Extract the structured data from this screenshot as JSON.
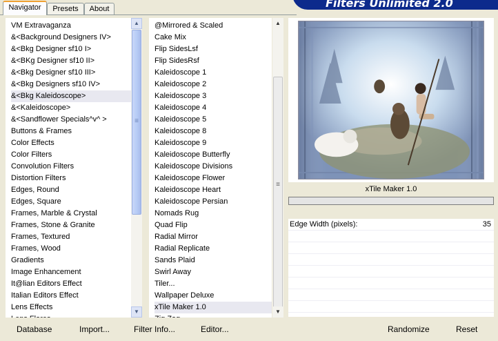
{
  "tabs": [
    {
      "label": "Navigator",
      "active": true
    },
    {
      "label": "Presets",
      "active": false
    },
    {
      "label": "About",
      "active": false
    }
  ],
  "logo_text": "Filters Unlimited 2.0",
  "categories": [
    "VM Extravaganza",
    "&<Background Designers IV>",
    "&<Bkg Designer sf10 I>",
    "&<BKg Designer sf10 II>",
    "&<Bkg Designer sf10 III>",
    "&<Bkg Designers sf10 IV>",
    "&<Bkg Kaleidoscope>",
    "&<Kaleidoscope>",
    "&<Sandflower Specials^v^ >",
    "Buttons & Frames",
    "Color Effects",
    "Color Filters",
    "Convolution Filters",
    "Distortion Filters",
    "Edges, Round",
    "Edges, Square",
    "Frames, Marble & Crystal",
    "Frames, Stone & Granite",
    "Frames, Textured",
    "Frames, Wood",
    "Gradients",
    "Image Enhancement",
    "It@lian Editors Effect",
    "Italian Editors Effect",
    "Lens Effects",
    "Lens Flares"
  ],
  "selected_category_index": 6,
  "filters": [
    "@Mirrored & Scaled",
    "Cake Mix",
    "Flip SidesLsf",
    "Flip SidesRsf",
    "Kaleidoscope 1",
    "Kaleidoscope 2",
    "Kaleidoscope 3",
    "Kaleidoscope 4",
    "Kaleidoscope 5",
    "Kaleidoscope 8",
    "Kaleidoscope 9",
    "Kaleidoscope Butterfly",
    "Kaleidoscope Divisions",
    "Kaleidoscope Flower",
    "Kaleidoscope Heart",
    "Kaleidoscope Persian",
    "Nomads Rug",
    "Quad Flip",
    "Radial Mirror",
    "Radial Replicate",
    "Sands Plaid",
    "Swirl Away",
    "Tiler...",
    "Wallpaper Deluxe",
    "xTile Maker 1.0",
    "Zig Zag"
  ],
  "selected_filter_index": 24,
  "filter_name": "xTile Maker 1.0",
  "params": [
    {
      "label": "Edge Width (pixels):",
      "value": "35"
    }
  ],
  "buttons": {
    "database": "Database",
    "import": "Import...",
    "filter_info": "Filter Info...",
    "editor": "Editor...",
    "randomize": "Randomize",
    "reset": "Reset"
  },
  "colors": {
    "logo_bg": "#0c2a8c",
    "panel_bg": "#ffffff",
    "window_bg": "#ece9d8"
  }
}
